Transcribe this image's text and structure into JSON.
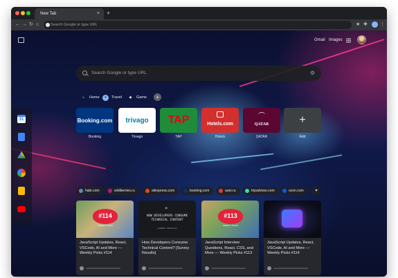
{
  "browser": {
    "tab_title": "New Tab",
    "tab_close": "×",
    "new_tab": "+",
    "omnibox_placeholder": "Search Google or type URL"
  },
  "ntp": {
    "links": {
      "gmail": "Gmail",
      "images": "Images"
    },
    "search_placeholder": "Search Google or type URL",
    "groups": [
      {
        "label": "Home",
        "icon": "home-icon"
      },
      {
        "label": "Travel",
        "icon": "travel-icon",
        "active": true
      },
      {
        "label": "Game",
        "icon": "game-icon"
      }
    ],
    "group_add": "+",
    "shortcuts": [
      {
        "label": "Booking",
        "brand": "Booking.com",
        "color": "#003580"
      },
      {
        "label": "Trivago",
        "brand": "trivago",
        "color": "#ffffff"
      },
      {
        "label": "TAP",
        "brand": "TAP",
        "color": "#e30613"
      },
      {
        "label": "Hotels",
        "brand": "Hotels.com",
        "color": "#d32f2f"
      },
      {
        "label": "QATAR",
        "brand": "QATAR",
        "color": "#5c0632"
      },
      {
        "label": "Add",
        "brand": "+",
        "color": "#3c4043"
      }
    ],
    "dock": [
      {
        "icon": "calendar-icon",
        "text": "31"
      },
      {
        "icon": "docs-icon"
      },
      {
        "icon": "drive-icon"
      },
      {
        "icon": "photos-icon"
      },
      {
        "icon": "slides-icon"
      },
      {
        "icon": "youtube-icon"
      }
    ],
    "chips": [
      {
        "label": "habr.com",
        "color": "#5b8bb3"
      },
      {
        "label": "wildberries.ru",
        "color": "#b3197a"
      },
      {
        "label": "aliexpress.com",
        "color": "#e64a19"
      },
      {
        "label": "booking.com",
        "color": "#003580"
      },
      {
        "label": "auto.ru",
        "color": "#e53935"
      },
      {
        "label": "tripadvisor.com",
        "color": "#34e0a1"
      },
      {
        "label": "ozon.com",
        "color": "#005bff"
      }
    ],
    "chip_more": "▾",
    "cards": [
      {
        "title": "JavaScript Updates, React, VSCode, AI and More — Weekly Picks #114",
        "badge": "#114",
        "badge_sub": "WEEKLY PICKS"
      },
      {
        "title": "How Developers Consume Technical Content? [Survey Results]",
        "image_title": "HOW DEVELOPERS CONSUME TECHNICAL CONTENT",
        "image_sub": "[SURVEY RESULTS]"
      },
      {
        "title": "JavaScript Interview Questions, React, CSS, and More — Weekly Picks #113",
        "badge": "#113",
        "badge_sub": "WEEKLY PICKS"
      },
      {
        "title": "JavaScript Updates, React, VSCode, AI and More — Weekly Picks #114"
      }
    ]
  },
  "colors": {
    "accent": "#8ab4f8",
    "badge_red": "#e2233b"
  }
}
